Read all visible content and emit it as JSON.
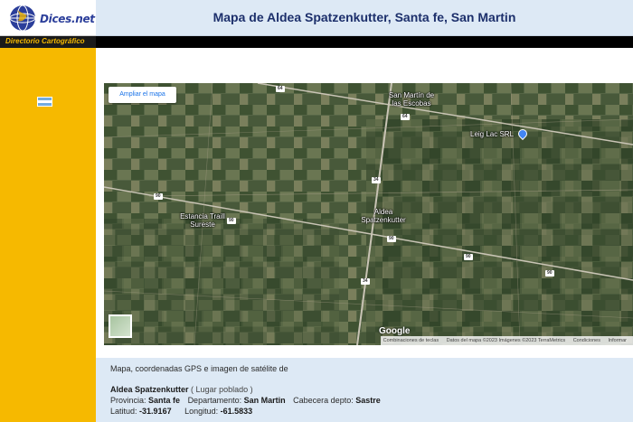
{
  "logo": {
    "text": "Dices.net"
  },
  "header": {
    "title": "Mapa de Aldea Spatzenkutter, Santa fe, San Martin"
  },
  "sidebar": {
    "directory_label": "Directorio Cartográfico",
    "flag": "argentina-flag"
  },
  "map": {
    "ampliar_label": "Ampliar el mapa",
    "labels": {
      "san_martin": "San Martín de las Escobas",
      "leig": "Leig Lac SRL",
      "estancia": "Estancia Traill Sureste",
      "aldea": "Aldea Spatzenkutter"
    },
    "routes": {
      "r64a": "64",
      "r64b": "64",
      "r34a": "34",
      "r34b": "34",
      "r90a": "90",
      "r90b": "90",
      "r90c": "90",
      "r90d": "90",
      "r90e": "90"
    },
    "google": "Google",
    "attribution": {
      "shortcuts": "Combinaciones de teclas",
      "data": "Datos del mapa ©2023 Imágenes ©2023 TerraMetrics",
      "terms": "Condiciones",
      "report": "Informar"
    },
    "colors": {
      "pin": "#4285f4"
    }
  },
  "info": {
    "intro": "Mapa, coordenadas GPS e imagen de satélite de",
    "place_name": "Aldea Spatzenkutter",
    "place_type": "( Lugar poblado )",
    "provincia_label": "Provincia:",
    "provincia_value": "Santa fe",
    "departamento_label": "Departamento:",
    "departamento_value": "San Martin",
    "cabecera_label": "Cabecera depto:",
    "cabecera_value": "Sastre",
    "latitud_label": "Latitud:",
    "latitud_value": "-31.9167",
    "longitud_label": "Longitud:",
    "longitud_value": "-61.5833"
  }
}
